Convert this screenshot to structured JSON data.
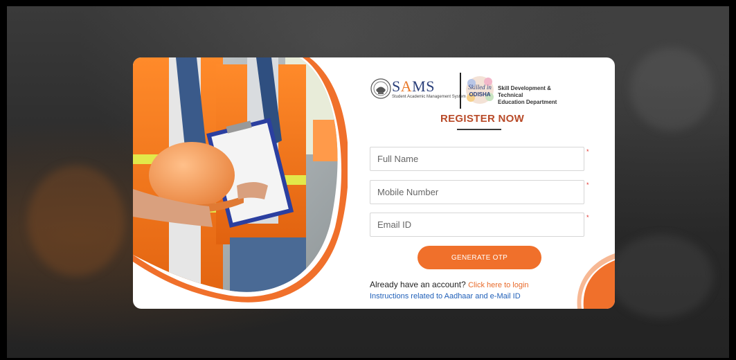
{
  "brand": {
    "sams_prefix": "S",
    "sams_accent": "A",
    "sams_suffix": "MS",
    "sams_subtitle": "Student Academic Management System",
    "partner_logo_line1": "Skilled in",
    "partner_logo_line2": "ODISHA",
    "department_line1": "Skill Development & Technical",
    "department_line2": "Education Department"
  },
  "form": {
    "title": "REGISTER NOW",
    "fields": [
      {
        "placeholder": "Full Name",
        "value": "",
        "required_mark": "*"
      },
      {
        "placeholder": "Mobile Number",
        "value": "",
        "required_mark": "*"
      },
      {
        "placeholder": "Email ID",
        "value": "",
        "required_mark": "*"
      }
    ],
    "otp_button": "GENERATE OTP",
    "account_prompt": "Already have an account?",
    "login_link": "Click here to login",
    "aadhaar_link": "Instructions related to Aadhaar and e-Mail ID"
  },
  "icons": {
    "emblem": "odisha-emblem-icon",
    "partner": "skilled-in-odisha-logo"
  },
  "colors": {
    "accent_orange": "#f0702b",
    "title_red": "#b84a28",
    "link_blue": "#1f5fb8",
    "sams_blue": "#2a3f7a",
    "required_red": "#e0302a"
  }
}
